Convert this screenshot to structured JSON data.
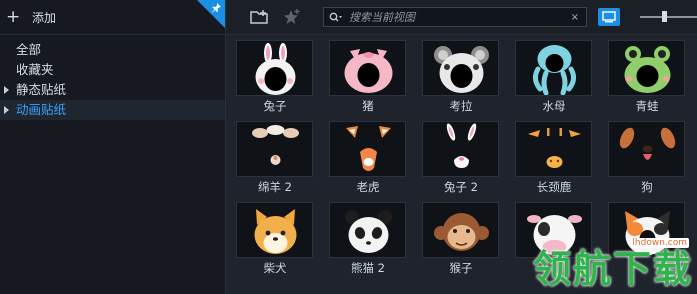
{
  "sidebar": {
    "add_label": "添加",
    "items": [
      {
        "label": "全部"
      },
      {
        "label": "收藏夹"
      },
      {
        "label": "静态贴纸"
      },
      {
        "label": "动画贴纸"
      }
    ]
  },
  "toolbar": {
    "search_placeholder": "搜索当前视图",
    "clear": "×"
  },
  "stickers": [
    {
      "label": "兔子"
    },
    {
      "label": "猪"
    },
    {
      "label": "考拉"
    },
    {
      "label": "水母"
    },
    {
      "label": "青蛙"
    },
    {
      "label": "绵羊 2"
    },
    {
      "label": "老虎"
    },
    {
      "label": "兔子 2"
    },
    {
      "label": "长颈鹿"
    },
    {
      "label": "狗"
    },
    {
      "label": "柴犬"
    },
    {
      "label": "熊猫 2"
    },
    {
      "label": "猴子"
    },
    {
      "label": ""
    },
    {
      "label": ""
    }
  ],
  "watermark": {
    "text": "领航下载",
    "url": "lhdown.com"
  },
  "colors": {
    "accent": "#1a8fe6",
    "selected_text": "#3aa1ff",
    "watermark": "#2fb34c"
  }
}
